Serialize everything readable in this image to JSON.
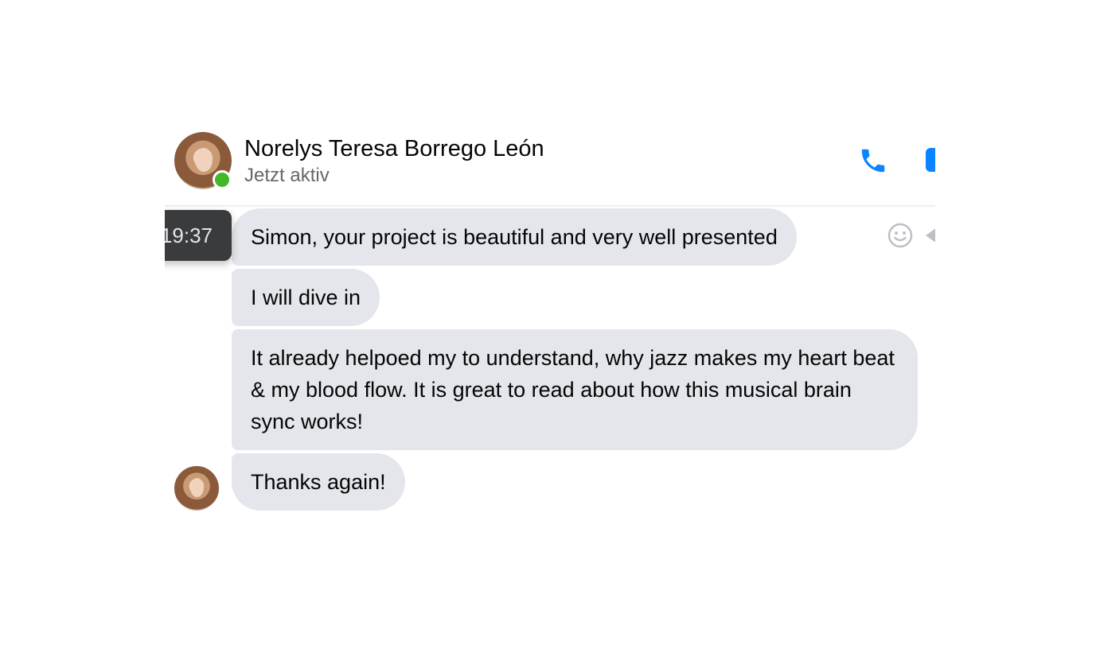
{
  "conversation": {
    "contact_name": "Norelys Teresa Borrego León",
    "status": "Jetzt aktiv",
    "presence_color": "#42b72a",
    "accent_color": "#0a84ff"
  },
  "header_actions": {
    "call_icon": "phone-icon",
    "video_icon": "video-camera-icon"
  },
  "messages": [
    {
      "text": "Simon, your project is beautiful and very well presented"
    },
    {
      "text": "I will dive in"
    },
    {
      "text": "It already helpoed my to understand, why jazz makes my heart beat & my blood flow. It is great to read about how this musical brain sync works!"
    },
    {
      "text": "Thanks again!"
    }
  ],
  "hover": {
    "timestamp": "19:37",
    "react_icon": "smiley-icon",
    "reply_icon": "reply-arrow-icon"
  }
}
